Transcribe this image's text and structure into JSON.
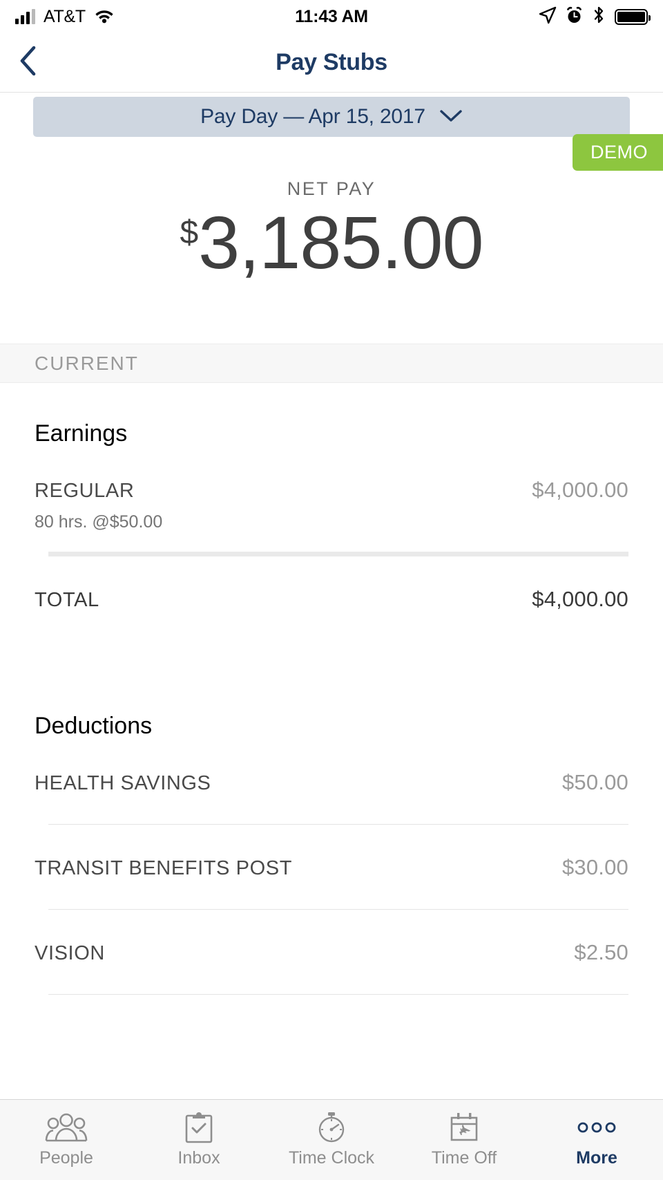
{
  "status_bar": {
    "carrier": "AT&T",
    "time": "11:43 AM",
    "icons": [
      "signal-icon",
      "wifi-icon",
      "location-arrow-icon",
      "alarm-clock-icon",
      "bluetooth-icon",
      "battery-icon"
    ]
  },
  "nav": {
    "back_icon": "chevron-left-icon",
    "title": "Pay Stubs"
  },
  "payday": {
    "label": "Pay Day — Apr 15, 2017",
    "chevron_icon": "chevron-down-icon"
  },
  "demo_badge": {
    "label": "DEMO",
    "color": "#8dc63f"
  },
  "net_pay": {
    "label": "NET PAY",
    "currency": "$",
    "value": "3,185.00"
  },
  "section": {
    "label": "CURRENT"
  },
  "earnings": {
    "title": "Earnings",
    "rows": [
      {
        "label": "REGULAR",
        "amount": "$4,000.00",
        "sub": "80 hrs. @$50.00"
      }
    ],
    "total": {
      "label": "TOTAL",
      "amount": "$4,000.00"
    }
  },
  "deductions": {
    "title": "Deductions",
    "rows": [
      {
        "label": "HEALTH SAVINGS",
        "amount": "$50.00"
      },
      {
        "label": "TRANSIT BENEFITS POST",
        "amount": "$30.00"
      },
      {
        "label": "VISION",
        "amount": "$2.50"
      }
    ]
  },
  "tab_bar": {
    "active_color": "#1e3b64",
    "tabs": [
      {
        "label": "People",
        "icon": "people-group-icon",
        "active": false
      },
      {
        "label": "Inbox",
        "icon": "clipboard-check-icon",
        "active": false
      },
      {
        "label": "Time Clock",
        "icon": "stopwatch-icon",
        "active": false
      },
      {
        "label": "Time Off",
        "icon": "calendar-airplane-icon",
        "active": false
      },
      {
        "label": "More",
        "icon": "three-dots-icon",
        "active": true
      }
    ]
  }
}
